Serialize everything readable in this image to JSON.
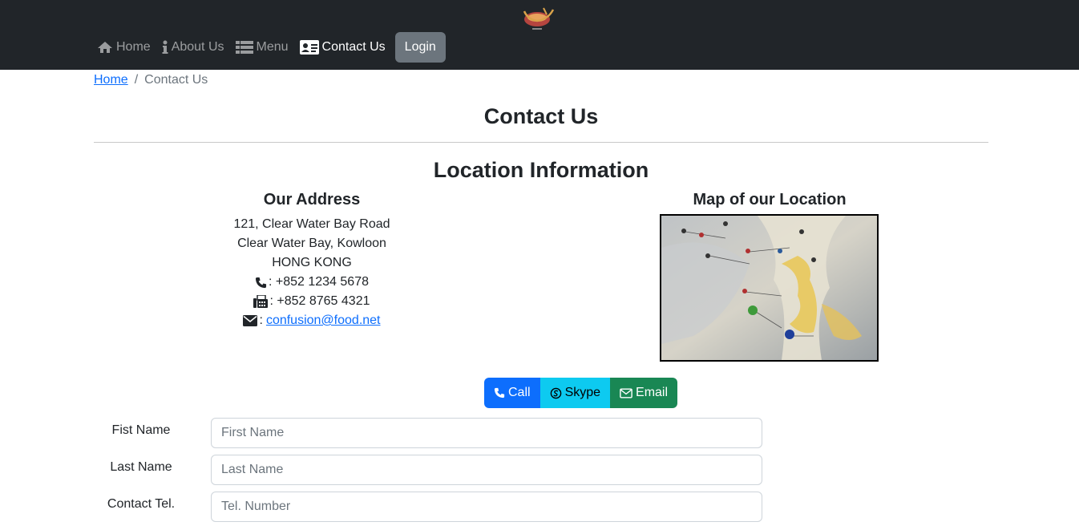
{
  "nav": {
    "items": [
      {
        "label": "Home",
        "icon": "home-icon"
      },
      {
        "label": "About Us",
        "icon": "info-icon"
      },
      {
        "label": "Menu",
        "icon": "list-icon"
      },
      {
        "label": "Contact Us",
        "icon": "address-card-icon"
      }
    ],
    "login_label": "Login"
  },
  "breadcrumb": {
    "home": "Home",
    "separator": "/",
    "current": "Contact Us"
  },
  "page_title": "Contact Us",
  "location_title": "Location Information",
  "address": {
    "heading": "Our Address",
    "line1": "121, Clear Water Bay Road",
    "line2": "Clear Water Bay, Kowloon",
    "line3": "HONG KONG",
    "phone": ": +852 1234 5678",
    "fax": ": +852 8765 4321",
    "email_prefix": ":",
    "email": "confusion@food.net"
  },
  "map": {
    "heading": "Map of our Location"
  },
  "actions": {
    "call": "Call",
    "skype": "Skype",
    "email": "Email"
  },
  "form": {
    "first_name": {
      "label": "Fist Name",
      "placeholder": "First Name",
      "value": ""
    },
    "last_name": {
      "label": "Last Name",
      "placeholder": "Last Name",
      "value": ""
    },
    "tel": {
      "label": "Contact Tel.",
      "placeholder": "Tel. Number",
      "value": ""
    }
  },
  "colors": {
    "navbar": "#212529",
    "primary": "#0d6efd",
    "info": "#0dcaf0",
    "success": "#198754",
    "secondary": "#6c757d"
  }
}
